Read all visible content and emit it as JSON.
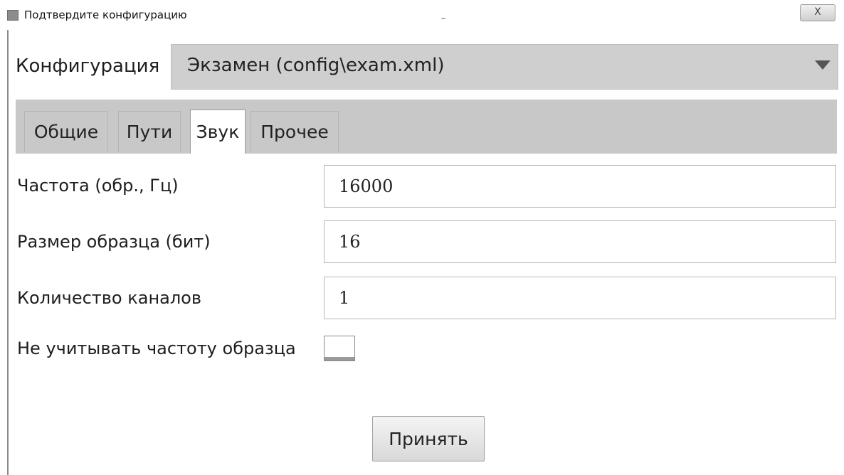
{
  "window": {
    "title": "Подтвердите конфигурацию",
    "minimize_label": "–",
    "close_label": "X"
  },
  "config": {
    "label": "Конфигурация",
    "selected_value": "Экзамен (config\\exam.xml)"
  },
  "tabs": [
    {
      "label": "Общие",
      "active": false
    },
    {
      "label": "Пути",
      "active": false
    },
    {
      "label": "Звук",
      "active": true
    },
    {
      "label": "Прочее",
      "active": false
    }
  ],
  "sound": {
    "sample_rate": {
      "label": "Частота (обр., Гц)",
      "value": "16000"
    },
    "sample_size": {
      "label": "Размер образца (бит)",
      "value": "16"
    },
    "channels": {
      "label": "Количество каналов",
      "value": "1"
    },
    "ignore_rate": {
      "label": "Не учитывать частоту образца",
      "checked": false
    }
  },
  "actions": {
    "accept_label": "Принять"
  }
}
